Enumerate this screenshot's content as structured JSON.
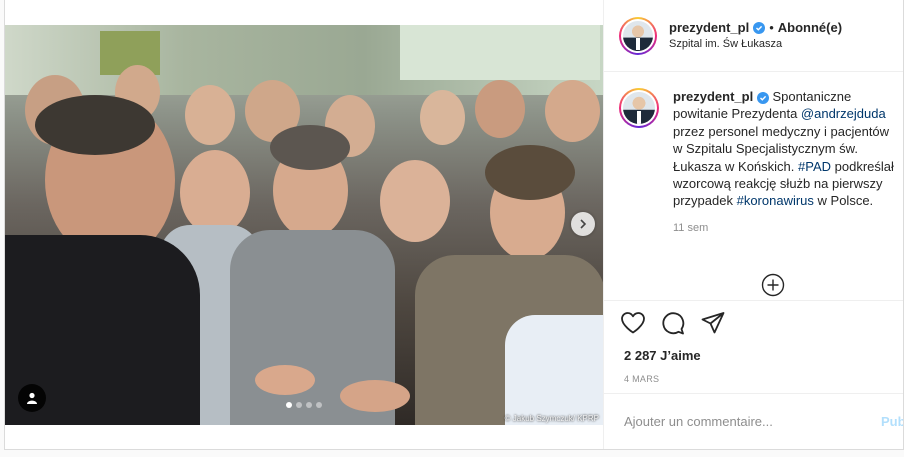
{
  "post": {
    "username": "prezydent_pl",
    "follow_status": "Abonné(e)",
    "separator": "•",
    "location": "Szpital im. Św Łukasza",
    "photo_credit": "© Jakub Szymczuk/ KPRP",
    "carousel_dots": 4,
    "caption": {
      "username": "prezydent_pl",
      "text_1": "Spontaniczne powitanie Prezydenta ",
      "mention": "@andrzejduda",
      "text_2": " przez personel medyczny i pacjentów w Szpitalu Specjalistycznym św. Łukasza w Końskich. ",
      "hashtag_1": "#PAD",
      "text_3": " podkreślał wzorcową reakcję służb na pierwszy przypadek ",
      "hashtag_2": "#koronawirus",
      "text_4": " w Polsce.",
      "time": "11 sem"
    },
    "likes": "2 287 J’aime",
    "date": "4 MARS",
    "comment_placeholder": "Ajouter un commentaire...",
    "publish_label": "Publier"
  },
  "icons": {
    "like": "heart-icon",
    "comment": "comment-icon",
    "share": "paper-plane-icon",
    "save": "bookmark-icon",
    "more_comments": "plus-circle-icon",
    "next": "chevron-right-icon",
    "tag": "user-tag-icon",
    "verified": "verified-badge-icon"
  },
  "colors": {
    "link": "#00376b",
    "verified": "#3897f0",
    "muted": "#8e8e8e",
    "publish_disabled": "#b2dffc"
  }
}
